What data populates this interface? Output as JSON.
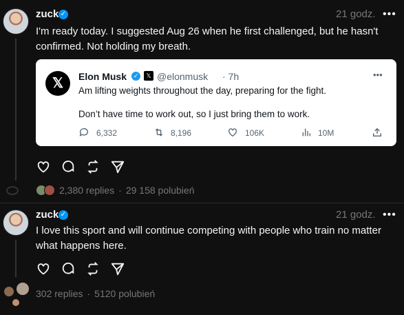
{
  "post1": {
    "author": "zuck",
    "time": "21 godz.",
    "more": "•••",
    "text": "I'm ready today. I suggested Aug 26 when he first challenged, but he hasn't confirmed. Not holding my breath.",
    "embed": {
      "author": "Elon Musk",
      "handle": "@elonmusk",
      "time": "· 7h",
      "more": "•••",
      "line1": "Am lifting weights throughout the day, preparing for the fight.",
      "line2": "Don’t have time to work out, so I just bring them to work.",
      "replies": "6,332",
      "reposts": "8,196",
      "likes": "106K",
      "views": "10M"
    },
    "replies": "2,380 replies",
    "separator": "·",
    "likes": "29 158 polubień"
  },
  "post2": {
    "author": "zuck",
    "time": "21 godz.",
    "more": "•••",
    "text": "I love this sport and will continue competing with people who train no matter what happens here.",
    "replies": "302 replies",
    "separator": "·",
    "likes": "5120 polubień"
  },
  "colors": {
    "background": "#101010",
    "text": "#f3f5f7",
    "muted": "#777777",
    "verified": "#0095f6"
  }
}
